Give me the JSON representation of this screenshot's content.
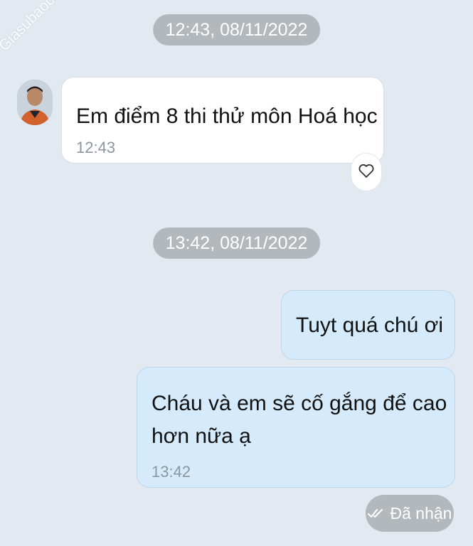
{
  "watermark": "Giasubaochau.net",
  "chat": {
    "timestamp_1": "12:43, 08/11/2022",
    "timestamp_2": "13:42, 08/11/2022",
    "incoming": {
      "text": "Em điểm 8 thi thử môn Hoá học",
      "time": "12:43"
    },
    "outgoing_1": {
      "text": "Tuyt quá chú ơi"
    },
    "outgoing_2": {
      "line1": "Cháu và em sẽ cố gắng để cao",
      "line2": "hơn nữa ạ",
      "time": "13:42"
    },
    "status": "Đã nhận"
  },
  "icons": {
    "reaction": "heart-icon",
    "delivered": "double-check-icon"
  },
  "colors": {
    "background": "#e2e9f1",
    "incoming_bubble": "#ffffff",
    "outgoing_bubble": "#d5ebfb",
    "pill": "#b3b8bd"
  }
}
